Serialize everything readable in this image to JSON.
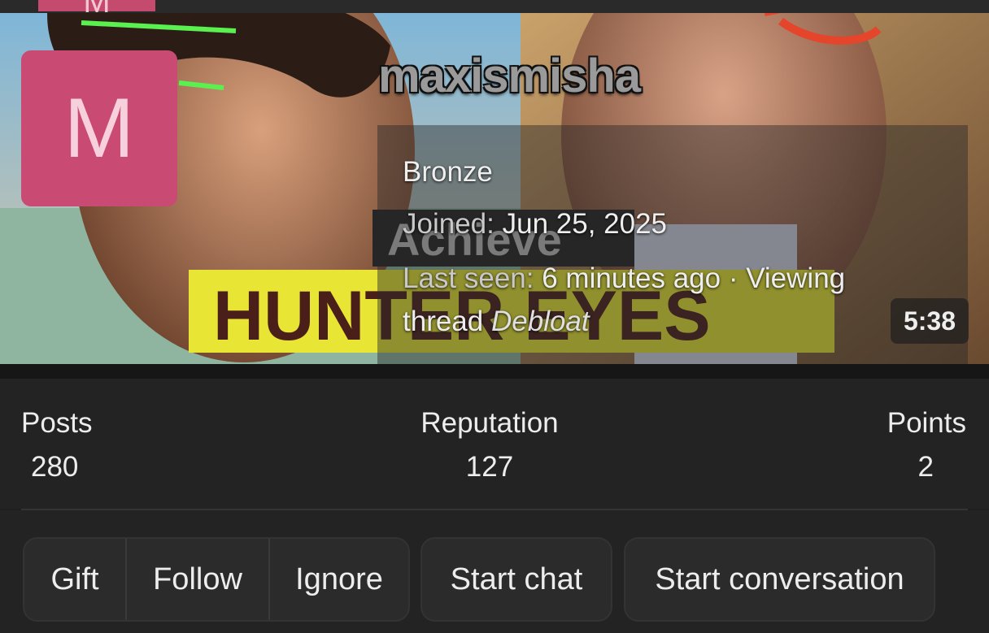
{
  "header": {
    "avatar_letter": "M"
  },
  "profile": {
    "avatar_letter": "M",
    "avatar_color": "#c94a73",
    "username": "maxismisha",
    "rank": "Bronze",
    "joined_label": "Joined:",
    "joined_value": "Jun 25, 2025",
    "last_seen_label": "Last seen:",
    "last_seen_value": "6 minutes ago · Viewing",
    "activity_prefix": "thread",
    "activity_thread": "Debloat"
  },
  "banner": {
    "overlay_text_1": "Achieve",
    "overlay_text_2": "HUNTER EYES",
    "video_duration": "5:38"
  },
  "stats": {
    "posts_label": "Posts",
    "posts_value": "280",
    "reputation_label": "Reputation",
    "reputation_value": "127",
    "points_label": "Points",
    "points_value": "2"
  },
  "actions": {
    "gift": "Gift",
    "follow": "Follow",
    "ignore": "Ignore",
    "start_chat": "Start chat",
    "start_conversation": "Start conversation"
  }
}
